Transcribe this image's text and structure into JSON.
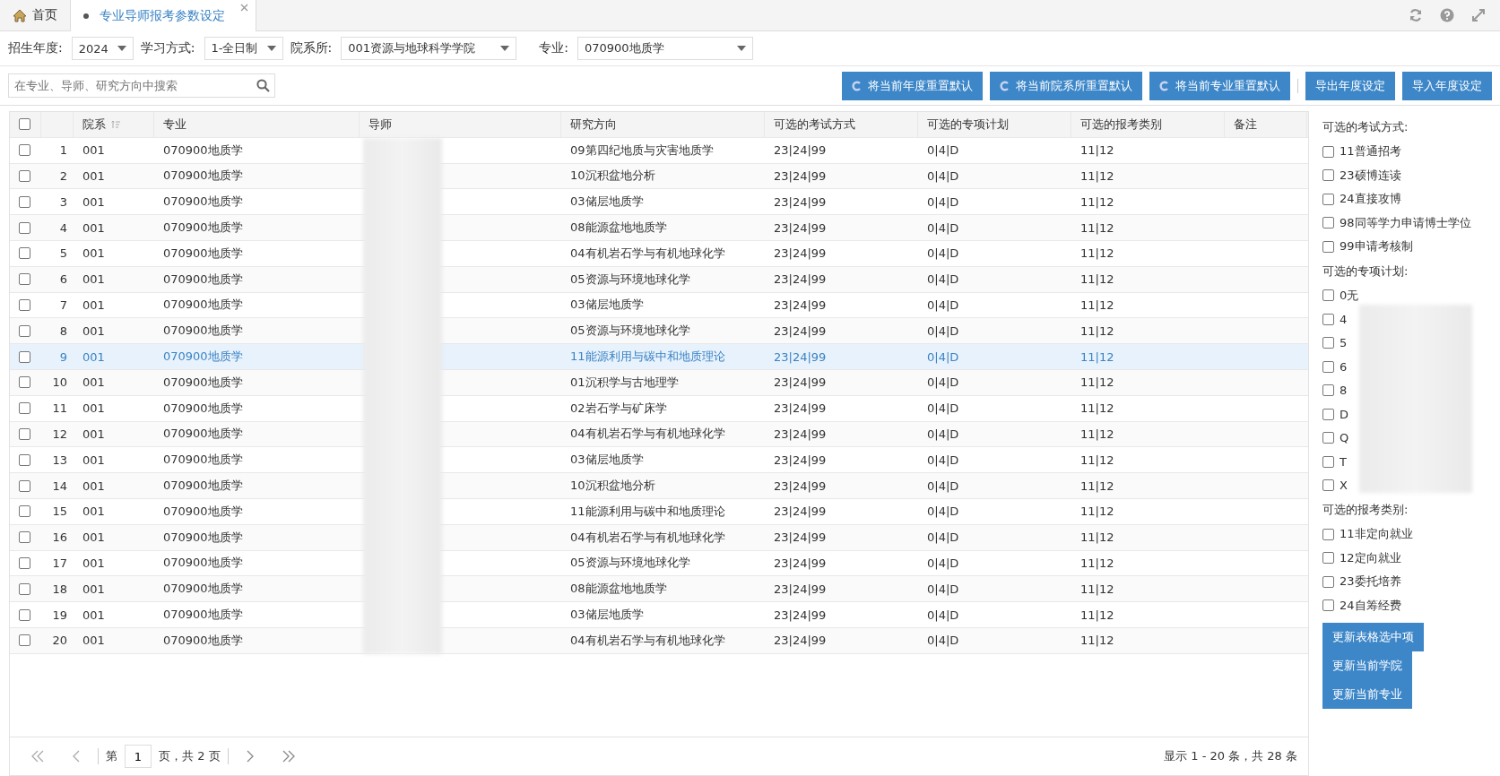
{
  "tabs": [
    {
      "label": "首页",
      "kind": "home",
      "selected": false,
      "closable": false
    },
    {
      "label": "专业导师报考参数设定",
      "kind": "page",
      "selected": true,
      "closable": true
    }
  ],
  "filters": [
    {
      "label": "招生年度:",
      "value": "2024",
      "kind": "narrow"
    },
    {
      "label": "学习方式:",
      "value": "1-全日制",
      "kind": "narrow"
    },
    {
      "label": "院系所:",
      "value": "001资源与地球科学学院",
      "kind": "wide"
    },
    {
      "label": "专业:",
      "value": "070900地质学",
      "kind": "wide"
    }
  ],
  "search": {
    "placeholder": "在专业、导师、研究方向中搜索"
  },
  "toolbar_buttons": [
    {
      "label": "将当前年度重置默认",
      "kind": "reset"
    },
    {
      "label": "将当前院系所重置默认",
      "kind": "reset"
    },
    {
      "label": "将当前专业重置默认",
      "kind": "reset"
    },
    {
      "label": "导出年度设定",
      "kind": "plain"
    },
    {
      "label": "导入年度设定",
      "kind": "plain"
    }
  ],
  "table": {
    "all_checked": false,
    "columns": [
      "院系",
      "专业",
      "导师",
      "研究方向",
      "可选的考试方式",
      "可选的专项计划",
      "可选的报考类别",
      "备注"
    ],
    "rows": [
      {
        "n": "1",
        "dept": "001",
        "major": "070900地质学",
        "direction": "09第四纪地质与灾害地质学",
        "exam": "23|24|99",
        "plan": "0|4|D",
        "category": "11|12",
        "checked": false,
        "selected": false
      },
      {
        "n": "2",
        "dept": "001",
        "major": "070900地质学",
        "direction": "10沉积盆地分析",
        "exam": "23|24|99",
        "plan": "0|4|D",
        "category": "11|12",
        "checked": false,
        "selected": false
      },
      {
        "n": "3",
        "dept": "001",
        "major": "070900地质学",
        "direction": "03储层地质学",
        "exam": "23|24|99",
        "plan": "0|4|D",
        "category": "11|12",
        "checked": false,
        "selected": false
      },
      {
        "n": "4",
        "dept": "001",
        "major": "070900地质学",
        "direction": "08能源盆地地质学",
        "exam": "23|24|99",
        "plan": "0|4|D",
        "category": "11|12",
        "checked": false,
        "selected": false
      },
      {
        "n": "5",
        "dept": "001",
        "major": "070900地质学",
        "direction": "04有机岩石学与有机地球化学",
        "exam": "23|24|99",
        "plan": "0|4|D",
        "category": "11|12",
        "checked": false,
        "selected": false
      },
      {
        "n": "6",
        "dept": "001",
        "major": "070900地质学",
        "direction": "05资源与环境地球化学",
        "exam": "23|24|99",
        "plan": "0|4|D",
        "category": "11|12",
        "checked": false,
        "selected": false
      },
      {
        "n": "7",
        "dept": "001",
        "major": "070900地质学",
        "direction": "03储层地质学",
        "exam": "23|24|99",
        "plan": "0|4|D",
        "category": "11|12",
        "checked": false,
        "selected": false
      },
      {
        "n": "8",
        "dept": "001",
        "major": "070900地质学",
        "direction": "05资源与环境地球化学",
        "exam": "23|24|99",
        "plan": "0|4|D",
        "category": "11|12",
        "checked": false,
        "selected": false
      },
      {
        "n": "9",
        "dept": "001",
        "major": "070900地质学",
        "direction": "11能源利用与碳中和地质理论",
        "exam": "23|24|99",
        "plan": "0|4|D",
        "category": "11|12",
        "checked": false,
        "selected": true
      },
      {
        "n": "10",
        "dept": "001",
        "major": "070900地质学",
        "direction": "01沉积学与古地理学",
        "exam": "23|24|99",
        "plan": "0|4|D",
        "category": "11|12",
        "checked": false,
        "selected": false
      },
      {
        "n": "11",
        "dept": "001",
        "major": "070900地质学",
        "direction": "02岩石学与矿床学",
        "exam": "23|24|99",
        "plan": "0|4|D",
        "category": "11|12",
        "checked": false,
        "selected": false
      },
      {
        "n": "12",
        "dept": "001",
        "major": "070900地质学",
        "direction": "04有机岩石学与有机地球化学",
        "exam": "23|24|99",
        "plan": "0|4|D",
        "category": "11|12",
        "checked": false,
        "selected": false
      },
      {
        "n": "13",
        "dept": "001",
        "major": "070900地质学",
        "direction": "03储层地质学",
        "exam": "23|24|99",
        "plan": "0|4|D",
        "category": "11|12",
        "checked": false,
        "selected": false
      },
      {
        "n": "14",
        "dept": "001",
        "major": "070900地质学",
        "direction": "10沉积盆地分析",
        "exam": "23|24|99",
        "plan": "0|4|D",
        "category": "11|12",
        "checked": false,
        "selected": false
      },
      {
        "n": "15",
        "dept": "001",
        "major": "070900地质学",
        "direction": "11能源利用与碳中和地质理论",
        "exam": "23|24|99",
        "plan": "0|4|D",
        "category": "11|12",
        "checked": false,
        "selected": false
      },
      {
        "n": "16",
        "dept": "001",
        "major": "070900地质学",
        "direction": "04有机岩石学与有机地球化学",
        "exam": "23|24|99",
        "plan": "0|4|D",
        "category": "11|12",
        "checked": false,
        "selected": false
      },
      {
        "n": "17",
        "dept": "001",
        "major": "070900地质学",
        "direction": "05资源与环境地球化学",
        "exam": "23|24|99",
        "plan": "0|4|D",
        "category": "11|12",
        "checked": false,
        "selected": false
      },
      {
        "n": "18",
        "dept": "001",
        "major": "070900地质学",
        "direction": "08能源盆地地质学",
        "exam": "23|24|99",
        "plan": "0|4|D",
        "category": "11|12",
        "checked": false,
        "selected": false
      },
      {
        "n": "19",
        "dept": "001",
        "major": "070900地质学",
        "direction": "03储层地质学",
        "exam": "23|24|99",
        "plan": "0|4|D",
        "category": "11|12",
        "checked": false,
        "selected": false
      },
      {
        "n": "20",
        "dept": "001",
        "major": "070900地质学",
        "direction": "04有机岩石学与有机地球化学",
        "exam": "23|24|99",
        "plan": "0|4|D",
        "category": "11|12",
        "checked": false,
        "selected": false
      }
    ]
  },
  "pagination": {
    "before": "第",
    "page": "1",
    "after": "页，共 2 页",
    "summary": "显示 1 - 20 条，共 28 条"
  },
  "side_panel": {
    "groups": [
      {
        "title": "可选的考试方式:",
        "items": [
          {
            "label": "11普通招考",
            "checked": false
          },
          {
            "label": "23硕博连读",
            "checked": false
          },
          {
            "label": "24直接攻博",
            "checked": false
          },
          {
            "label": "98同等学力申请博士学位",
            "checked": false
          },
          {
            "label": "99申请考核制",
            "checked": false
          }
        ]
      },
      {
        "title": "可选的专项计划:",
        "items": [
          {
            "label": "0无",
            "checked": false
          },
          {
            "label": "4",
            "checked": false
          },
          {
            "label": "5",
            "checked": false
          },
          {
            "label": "6",
            "checked": false
          },
          {
            "label": "8",
            "checked": false
          },
          {
            "label": "D",
            "checked": false
          },
          {
            "label": "Q",
            "checked": false
          },
          {
            "label": "T",
            "checked": false
          },
          {
            "label": "X",
            "checked": false
          }
        ]
      },
      {
        "title": "可选的报考类别:",
        "items": [
          {
            "label": "11非定向就业",
            "checked": false
          },
          {
            "label": "12定向就业",
            "checked": false
          },
          {
            "label": "23委托培养",
            "checked": false
          },
          {
            "label": "24自筹经费",
            "checked": false
          }
        ]
      }
    ],
    "buttons": [
      "更新表格选中项",
      "更新当前学院",
      "更新当前专业"
    ]
  }
}
